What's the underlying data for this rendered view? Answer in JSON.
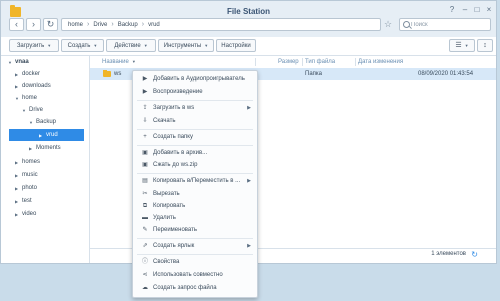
{
  "window": {
    "title": "File Station",
    "controls": [
      "?",
      "–",
      "□",
      "×"
    ]
  },
  "nav": {
    "back": "‹",
    "forward": "›",
    "refresh": "↻",
    "breadcrumb": [
      "home",
      "Drive",
      "Backup",
      "vrud"
    ],
    "favorite": "☆",
    "search_placeholder": "Поиск"
  },
  "toolbar": {
    "upload": "Загрузить",
    "create": "Создать",
    "action": "Действие",
    "tools": "Инструменты",
    "settings": "Настройки",
    "view_list": "☰",
    "view_sort": "↕"
  },
  "sidebar": {
    "items": [
      {
        "label": "vnaa",
        "level": 0,
        "expanded": true,
        "bold": true
      },
      {
        "label": "docker",
        "level": 1,
        "expanded": false
      },
      {
        "label": "downloads",
        "level": 1,
        "expanded": false
      },
      {
        "label": "home",
        "level": 1,
        "expanded": true
      },
      {
        "label": "Drive",
        "level": 2,
        "expanded": true
      },
      {
        "label": "Backup",
        "level": 3,
        "expanded": true
      },
      {
        "label": "vrud",
        "level": 4,
        "expanded": false,
        "selected": true
      },
      {
        "label": "Moments",
        "level": 3,
        "expanded": false
      },
      {
        "label": "homes",
        "level": 1,
        "expanded": false
      },
      {
        "label": "music",
        "level": 1,
        "expanded": false
      },
      {
        "label": "photo",
        "level": 1,
        "expanded": false
      },
      {
        "label": "test",
        "level": 1,
        "expanded": false
      },
      {
        "label": "video",
        "level": 1,
        "expanded": false
      }
    ]
  },
  "file_list": {
    "columns": {
      "name": "Название",
      "size": "Размер",
      "type": "Тип файла",
      "modified": "Дата изменения"
    },
    "rows": [
      {
        "name": "ws",
        "size": "",
        "type": "Папка",
        "modified": "08/09/2020 01:43:54"
      }
    ]
  },
  "footer": {
    "count": "1 элементов",
    "refresh": "↻"
  },
  "context_menu": {
    "items": [
      {
        "label": "Добавить в Аудиопроигрыватель",
        "icon": "▶"
      },
      {
        "label": "Воспроизведение",
        "icon": "▶"
      },
      {
        "label": "Загрузить в ws",
        "icon": "⇪",
        "submenu": true
      },
      {
        "label": "Скачать",
        "icon": "⇩"
      },
      {
        "label": "Создать папку",
        "icon": "+"
      },
      {
        "label": "Добавить в архив...",
        "icon": "▣"
      },
      {
        "label": "Сжать до ws.zip",
        "icon": "▣"
      },
      {
        "label": "Копировать в/Переместить в ...",
        "icon": "▤",
        "submenu": true
      },
      {
        "label": "Вырезать",
        "icon": "✂"
      },
      {
        "label": "Копировать",
        "icon": "⧉"
      },
      {
        "label": "Удалить",
        "icon": "▬"
      },
      {
        "label": "Переименовать",
        "icon": "✎"
      },
      {
        "label": "Создать ярлык",
        "icon": "⇗",
        "submenu": true
      },
      {
        "label": "Свойства",
        "icon": "ⓘ"
      },
      {
        "label": "Использовать совместно",
        "icon": "⋖"
      },
      {
        "label": "Создать запрос файла",
        "icon": "☁"
      }
    ],
    "submenu_arrow": "▶"
  },
  "colors": {
    "accent": "#2f8be6",
    "selected_row": "#d7e8f8",
    "folder": "#f0b529"
  }
}
